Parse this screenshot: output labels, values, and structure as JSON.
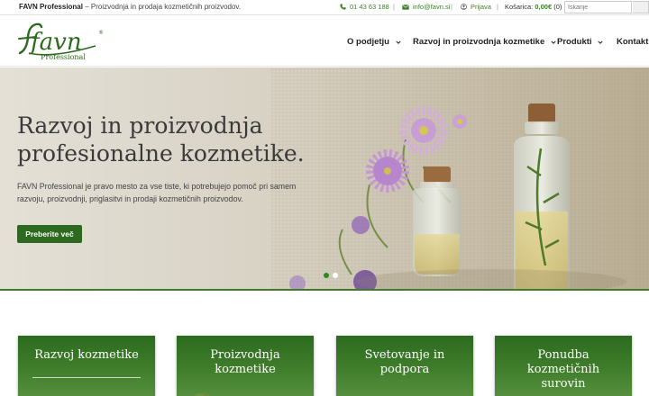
{
  "topbar": {
    "brand": "FAVN Professional",
    "tagline_rest": " – Proizvodnja in prodaja kozmetičnih proizvodov.",
    "phone": "01 43 63 188",
    "email": "info@favn.si",
    "login": "Prijava",
    "cart_label": "Košarica:",
    "cart_total": "0,00€",
    "cart_count": "(0)",
    "separator": "|",
    "search_placeholder": "Iskanje"
  },
  "header": {
    "logo_word": "favn",
    "logo_sub": "Professional",
    "logo_mark": "®",
    "nav": [
      {
        "label": "O podjetju",
        "has_dropdown": true
      },
      {
        "label": "Razvoj in proizvodnja kozmetike",
        "has_dropdown": true
      },
      {
        "label": "Produkti",
        "has_dropdown": true
      },
      {
        "label": "Kontakt",
        "has_dropdown": false
      }
    ]
  },
  "hero": {
    "title_line1": "Razvoj in proizvodnja",
    "title_line2": "profesionalne kozmetike.",
    "text_line1": "FAVN Professional je pravo mesto za vse tiste, ki potrebujejo pomoč pri samem",
    "text_line2": "razvoju, proizvodnji, priglasitvi in prodaji kozmetičnih proizvodov.",
    "button": "Preberite več",
    "slides": 2,
    "active_slide": 1
  },
  "cards": [
    {
      "line1": "Razvoj kozmetike",
      "line2": "",
      "line3": ""
    },
    {
      "line1": "Proizvodnja",
      "line2": "kozmetike",
      "line3": ""
    },
    {
      "line1": "Svetovanje in",
      "line2": "podpora",
      "line3": ""
    },
    {
      "line1": "Ponudba",
      "line2": "kozmetičnih",
      "line3": "surovin"
    }
  ],
  "colors": {
    "brand_green": "#2c6b1f",
    "accent_green": "#3f7d2b"
  },
  "icons": {
    "phone": "phone-icon",
    "email": "envelope-icon",
    "login": "user-icon",
    "search": "search-icon",
    "dropdown": "chevron-down-icon"
  }
}
